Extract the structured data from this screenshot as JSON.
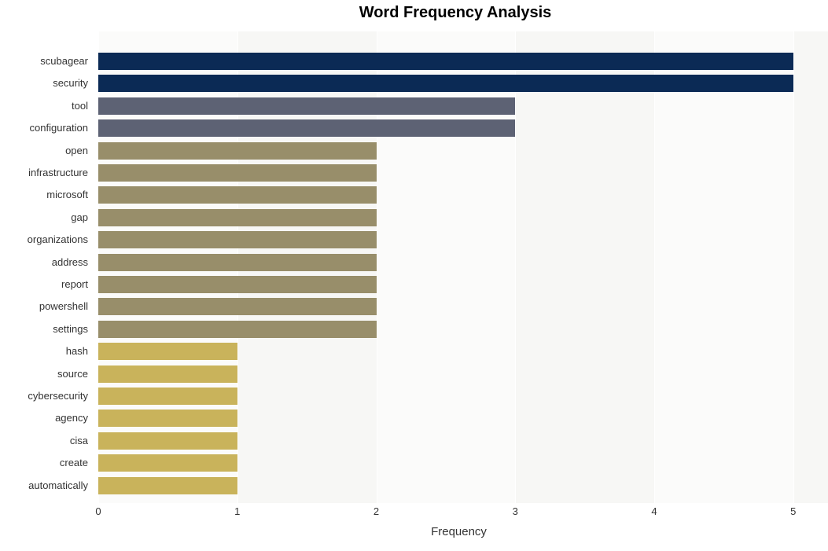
{
  "chart_data": {
    "type": "bar",
    "orientation": "horizontal",
    "title": "Word Frequency Analysis",
    "xlabel": "Frequency",
    "ylabel": "",
    "xlim": [
      0,
      5.25
    ],
    "categories": [
      "scubagear",
      "security",
      "tool",
      "configuration",
      "open",
      "infrastructure",
      "microsoft",
      "gap",
      "organizations",
      "address",
      "report",
      "powershell",
      "settings",
      "hash",
      "source",
      "cybersecurity",
      "agency",
      "cisa",
      "create",
      "automatically"
    ],
    "values": [
      5,
      5,
      3,
      3,
      2,
      2,
      2,
      2,
      2,
      2,
      2,
      2,
      2,
      1,
      1,
      1,
      1,
      1,
      1,
      1
    ],
    "colors": [
      "#0b2a55",
      "#0b2a55",
      "#5d6274",
      "#5d6274",
      "#988e6a",
      "#988e6a",
      "#988e6a",
      "#988e6a",
      "#988e6a",
      "#988e6a",
      "#988e6a",
      "#988e6a",
      "#988e6a",
      "#c9b35b",
      "#c9b35b",
      "#c9b35b",
      "#c9b35b",
      "#c9b35b",
      "#c9b35b",
      "#c9b35b"
    ],
    "xticks": [
      0,
      1,
      2,
      3,
      4,
      5
    ]
  }
}
